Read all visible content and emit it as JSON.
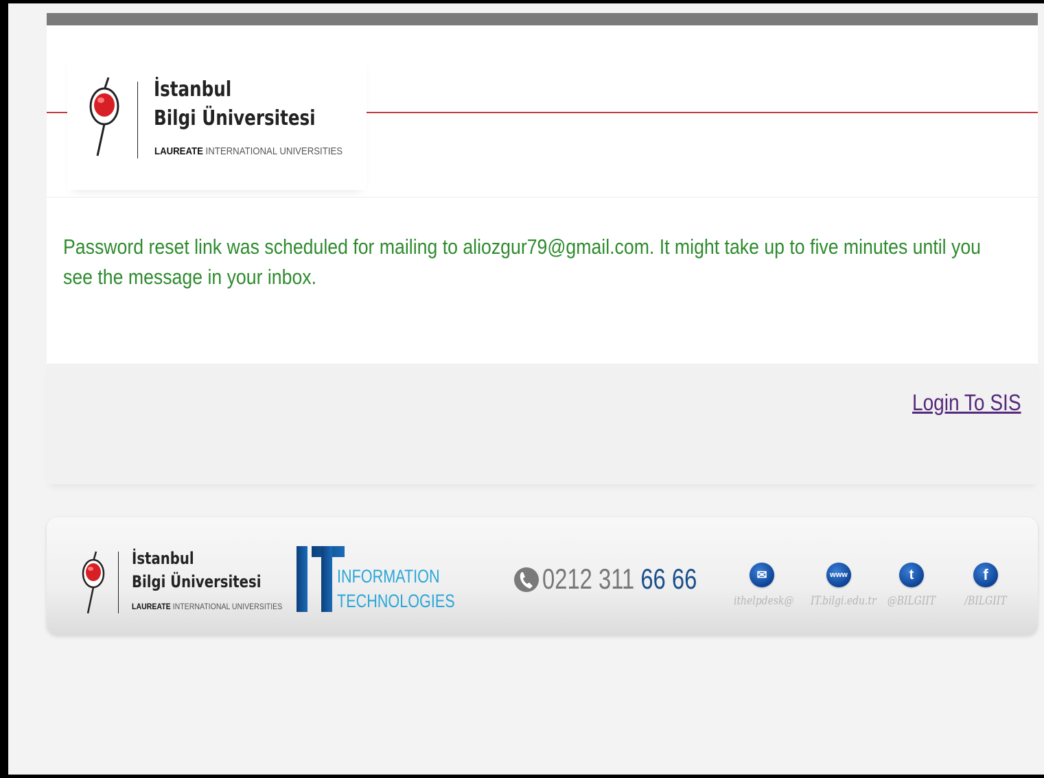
{
  "header": {
    "logo_line1": "İstanbul",
    "logo_line2": "Bilgi Üniversitesi",
    "logo_tag_bold": "LAUREATE",
    "logo_tag_rest": " INTERNATIONAL UNIVERSITIES"
  },
  "message": {
    "text": "Password reset link was scheduled for mailing to aliozgur79@gmail.com. It might take up to five minutes until you see the message in your inbox."
  },
  "login": {
    "link_text": "Login To SIS"
  },
  "footer": {
    "logo_line1": "İstanbul",
    "logo_line2": "Bilgi Üniversitesi",
    "logo_tag_bold": "LAUREATE",
    "logo_tag_rest": " INTERNATIONAL UNIVERSITIES",
    "it_mark": "IT",
    "it_line1": "INFORMATION",
    "it_line2": "TECHNOLOGIES",
    "phone_light": "0212 311 ",
    "phone_bold": "66 66",
    "social": [
      {
        "icon": "mail-icon",
        "glyph": "✉",
        "label": "ithelpdesk@"
      },
      {
        "icon": "www-icon",
        "glyph": "www",
        "label": "IT.bilgi.edu.tr"
      },
      {
        "icon": "twitter-icon",
        "glyph": "t",
        "label": "@BILGIIT"
      },
      {
        "icon": "facebook-icon",
        "glyph": "f",
        "label": "/BILGIIT"
      }
    ]
  },
  "colors": {
    "brand_red": "#c9383e",
    "message_green": "#2e8b2e",
    "link_purple": "#54287a",
    "it_blue": "#1a4f8a",
    "it_cyan": "#2aa6d8"
  }
}
